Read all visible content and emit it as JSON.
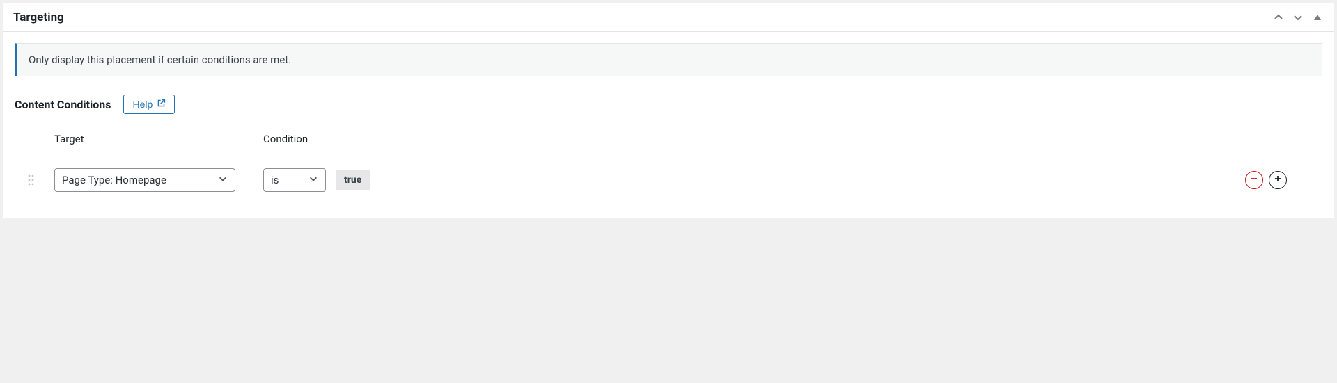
{
  "panel": {
    "title": "Targeting",
    "info": "Only display this placement if certain conditions are met."
  },
  "section": {
    "title": "Content Conditions",
    "help_label": "Help"
  },
  "table": {
    "headers": {
      "target": "Target",
      "condition": "Condition"
    },
    "row": {
      "target_value": "Page Type: Homepage",
      "condition_operator": "is",
      "condition_value": "true"
    }
  }
}
